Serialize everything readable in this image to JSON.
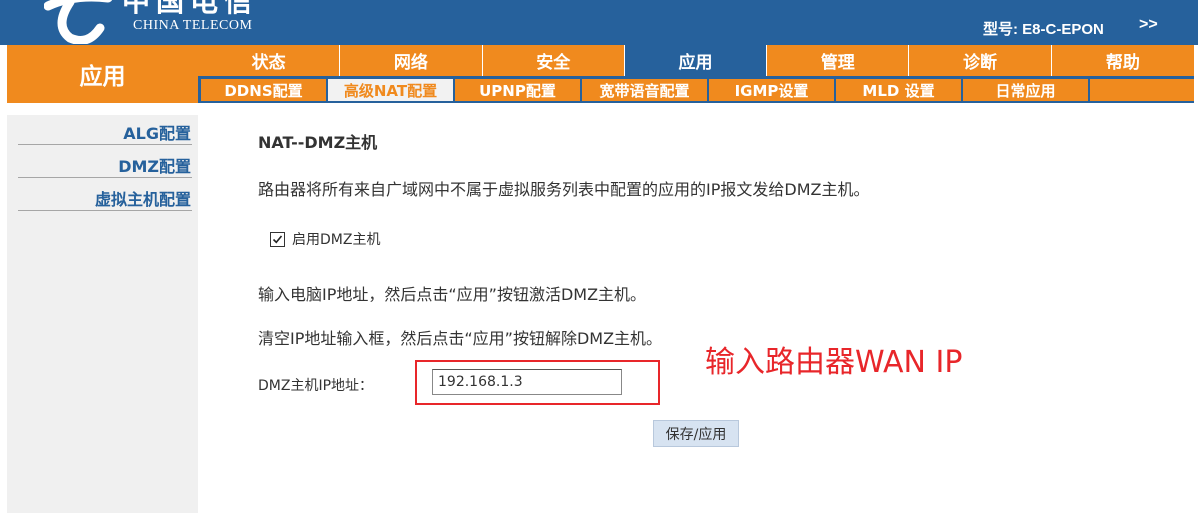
{
  "header": {
    "logo_cn": "中国电信",
    "logo_en": "CHINA TELECOM",
    "model": "型号: E8-C-EPON",
    "model_arrow": ">>"
  },
  "section_label": "应用",
  "main_nav": [
    "状态",
    "网络",
    "安全",
    "应用",
    "管理",
    "诊断",
    "帮助"
  ],
  "main_nav_active": "应用",
  "sub_nav": [
    "DDNS配置",
    "高级NAT配置",
    "UPNP配置",
    "宽带语音配置",
    "IGMP设置",
    "MLD 设置",
    "日常应用"
  ],
  "sub_nav_active": "高级NAT配置",
  "sidebar": [
    "ALG配置",
    "DMZ配置",
    "虚拟主机配置"
  ],
  "content": {
    "title": "NAT--DMZ主机",
    "desc1": "路由器将所有来自广域网中不属于虚拟服务列表中配置的应用的IP报文发给DMZ主机。",
    "enable_label": "启用DMZ主机",
    "enable_checked": true,
    "desc2": "输入电脑IP地址，然后点击“应用”按钮激活DMZ主机。",
    "desc3": "清空IP地址输入框，然后点击“应用”按钮解除DMZ主机。",
    "ip_label": "DMZ主机IP地址：",
    "ip_value": "192.168.1.3",
    "save_button": "保存/应用"
  },
  "annotation": {
    "text": "输入路由器WAN IP",
    "color": "#e8262a"
  },
  "colors": {
    "brand_blue": "#26619c",
    "brand_orange": "#f08a1e"
  }
}
